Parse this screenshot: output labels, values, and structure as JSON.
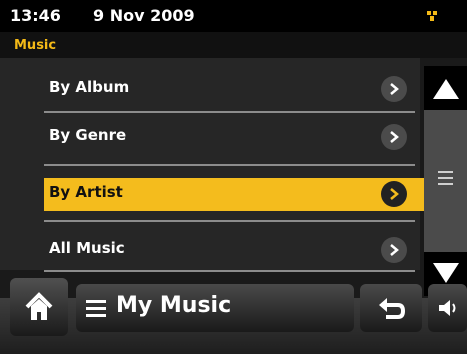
{
  "status": {
    "time": "13:46",
    "date": "9 Nov 2009",
    "signal_icon": "signal-icon",
    "accent": "#f3b917"
  },
  "section": {
    "title": "Music"
  },
  "menu": {
    "items": [
      {
        "label": "By Album",
        "selected": false
      },
      {
        "label": "By Genre",
        "selected": false
      },
      {
        "label": "By Artist",
        "selected": true
      },
      {
        "label": "All Music",
        "selected": false
      }
    ],
    "selected_color": "#f4bc1d"
  },
  "scrollbar": {
    "up_icon": "chevron-up-icon",
    "down_icon": "chevron-down-icon"
  },
  "bottom": {
    "home_icon": "home-icon",
    "menu_label": "My Music",
    "back_icon": "back-icon",
    "volume_icon": "volume-icon"
  }
}
